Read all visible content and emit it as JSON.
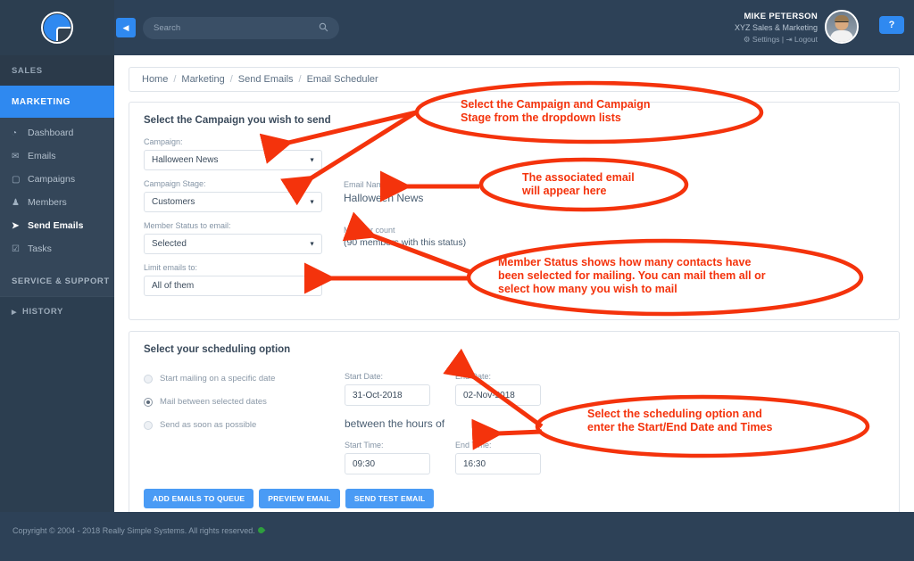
{
  "brand": {
    "accent": "#2f89f0",
    "sidebar_bg": "#2c3e50",
    "annotation_color": "#f4330c"
  },
  "sidebar": {
    "logo_name": "really-simple-systems-logo",
    "sections": [
      {
        "label": "SALES",
        "active": false
      },
      {
        "label": "MARKETING",
        "active": true
      },
      {
        "label": "SERVICE & SUPPORT",
        "active": false
      },
      {
        "label": "HISTORY",
        "active": false
      }
    ],
    "items": [
      {
        "label": "Dashboard",
        "icon": "dashboard-icon",
        "glyph": "◔",
        "selected": false
      },
      {
        "label": "Emails",
        "icon": "envelope-icon",
        "glyph": "✉",
        "selected": false
      },
      {
        "label": "Campaigns",
        "icon": "briefcase-icon",
        "glyph": "▢",
        "selected": false
      },
      {
        "label": "Members",
        "icon": "people-icon",
        "glyph": "♟",
        "selected": false
      },
      {
        "label": "Send Emails",
        "icon": "paper-plane-icon",
        "glyph": "➤",
        "selected": true
      },
      {
        "label": "Tasks",
        "icon": "checklist-icon",
        "glyph": "☑",
        "selected": false
      }
    ]
  },
  "topbar": {
    "collapse_icon": "collapse-left-icon",
    "collapse_glyph": "◀",
    "search": {
      "placeholder": "Search",
      "value": "",
      "icon": "search-icon",
      "glyph": "⚲"
    },
    "user": {
      "name": "MIKE PETERSON",
      "company": "XYZ Sales & Marketing",
      "settings_label": "Settings",
      "settings_icon": "gear-icon",
      "settings_glyph": "⚙",
      "separator": "|",
      "logout_label": "Logout",
      "logout_icon": "logout-icon",
      "logout_glyph": "↪",
      "avatar_name": "user-avatar"
    },
    "help_label": "?"
  },
  "breadcrumb": {
    "items": [
      "Home",
      "Marketing",
      "Send Emails",
      "Email Scheduler"
    ],
    "separator": "/"
  },
  "campaign_card": {
    "title": "Select the Campaign you wish to send",
    "fields": [
      {
        "label": "Campaign:",
        "value": "Halloween News"
      },
      {
        "label": "Campaign Stage:",
        "value": "Customers"
      },
      {
        "label": "Member Status to email:",
        "value": "Selected"
      },
      {
        "label": "Limit emails to:",
        "value": "All of them"
      }
    ],
    "email_name_label": "Email Name:",
    "email_name_value": "Halloween News",
    "member_count_label": "Member count",
    "member_count_value": "(90 members with this status)"
  },
  "schedule_card": {
    "title": "Select your scheduling option",
    "options": [
      {
        "label": "Start mailing on a specific date",
        "selected": false
      },
      {
        "label": "Mail between selected dates",
        "selected": true
      },
      {
        "label": "Send as soon as possible",
        "selected": false
      }
    ],
    "start_date_label": "Start Date:",
    "start_date_value": "31-Oct-2018",
    "end_date_label": "End Date:",
    "end_date_value": "02-Nov-2018",
    "between_text": "between the hours of",
    "start_time_label": "Start Time:",
    "start_time_value": "09:30",
    "end_time_label": "End Time:",
    "end_time_value": "16:30",
    "buttons": [
      {
        "label": "ADD EMAILS TO QUEUE"
      },
      {
        "label": "PREVIEW EMAIL"
      },
      {
        "label": "SEND TEST EMAIL"
      }
    ]
  },
  "footer": {
    "copyright": "Copyright © 2004 - 2018 Really Simple Systems. All rights reserved."
  },
  "annotations": [
    {
      "id": "a1",
      "text": "Select the Campaign and Campaign\nStage from the dropdown lists"
    },
    {
      "id": "a2",
      "text": "The associated email\nwill appear here"
    },
    {
      "id": "a3",
      "text": "Member Status shows how many contacts have\nbeen selected for mailing. You can mail them all or\nselect how many you wish to mail"
    },
    {
      "id": "a4",
      "text": "Select the scheduling option and\nenter the Start/End Date and Times"
    }
  ]
}
